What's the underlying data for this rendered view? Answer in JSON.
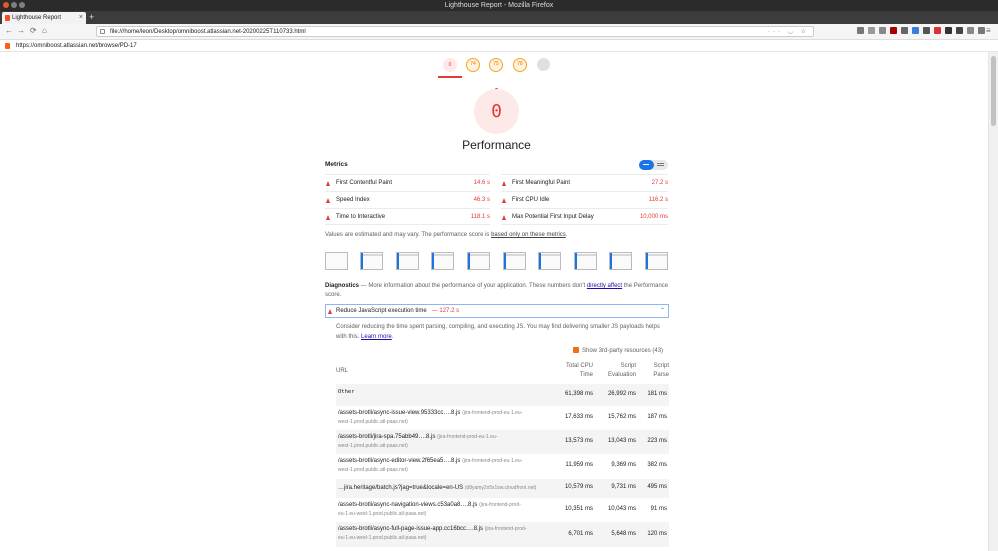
{
  "window": {
    "title": "Lighthouse Report - Mozilla Firefox"
  },
  "tab": {
    "title": "Lighthouse Report"
  },
  "navigation": {
    "url": "file:///home/leon/Desktop/omniboost.atlassian.net-20200225T110733.html"
  },
  "report_url": "https://omniboost.atlassian.net/browse/PD-17",
  "category_gauges": [
    {
      "score": "0",
      "status": "fail"
    },
    {
      "score": "74",
      "status": "average"
    },
    {
      "score": "75",
      "status": "average"
    },
    {
      "score": "78",
      "status": "average"
    },
    {
      "score": "",
      "status": "pwa"
    }
  ],
  "performance": {
    "score": "0",
    "title": "Performance"
  },
  "metrics": {
    "heading": "Metrics",
    "items": [
      {
        "label": "First Contentful Paint",
        "value": "14.6 s"
      },
      {
        "label": "First Meaningful Paint",
        "value": "27.2 s"
      },
      {
        "label": "Speed Index",
        "value": "46.3 s"
      },
      {
        "label": "First CPU Idle",
        "value": "116.2 s"
      },
      {
        "label": "Time to Interactive",
        "value": "118.1 s"
      },
      {
        "label": "Max Potential First Input Delay",
        "value": "10,000 ms"
      }
    ],
    "note_prefix": "Values are estimated and may vary. The performance score is ",
    "note_link": "based only on these metrics",
    "note_suffix": "."
  },
  "diagnostics": {
    "heading": "Diagnostics",
    "text_prefix": " — More information about the performance of your application. These numbers don't ",
    "link": "directly affect",
    "text_suffix": " the Performance score."
  },
  "opportunity": {
    "title": "Reduce JavaScript execution time",
    "value": "— 127.2 s",
    "description": "Consider reducing the time spent parsing, compiling, and executing JS. You may find delivering smaller JS payloads helps with this. ",
    "learn_more": "Learn more",
    "learn_more_suffix": "."
  },
  "third_party": {
    "label": "Show 3rd-party resources (43)"
  },
  "table": {
    "headers": {
      "url": "URL",
      "total_1": "Total CPU",
      "total_2": "Time",
      "eval_1": "Script",
      "eval_2": "Evaluation",
      "parse_1": "Script",
      "parse_2": "Parse"
    },
    "rows": [
      {
        "url": "Other",
        "host": "",
        "cont": "",
        "total": "61,398 ms",
        "eval": "26,992 ms",
        "parse": "181 ms"
      },
      {
        "url": "/assets-brotli/async-issue-view.95333cc….8.js",
        "host": "(jira-frontend-prod-eu-1.eu-",
        "cont": "west-1.prod.public.atl-paas.net)",
        "total": "17,633 ms",
        "eval": "15,762 ms",
        "parse": "187 ms"
      },
      {
        "url": "/assets-brotli/jira-spa.75abb49….8.js",
        "host": "(jira-frontend-prod-eu-1.eu-",
        "cont": "west-1.prod.public.atl-paas.net)",
        "total": "13,573 ms",
        "eval": "13,043 ms",
        "parse": "223 ms"
      },
      {
        "url": "/assets-brotli/async-editor-view.2f65ea5….8.js",
        "host": "(jira-frontend-prod-eu-1.eu-",
        "cont": "west-1.prod.public.atl-paas.net)",
        "total": "11,959 ms",
        "eval": "9,369 ms",
        "parse": "382 ms"
      },
      {
        "url": "…jira.heritage/batch.js?jag=true&locale=en-US",
        "host": "(d8yamy2x5x1sw.cloudfront.net)",
        "cont": "",
        "total": "10,579 ms",
        "eval": "9,731 ms",
        "parse": "495 ms"
      },
      {
        "url": "/assets-brotli/async-navigation-views.c53a0a8….8.js",
        "host": "(jira-frontend-prod-",
        "cont": "eu-1.eu-west-1.prod.public.atl-paas.net)",
        "total": "10,351 ms",
        "eval": "10,043 ms",
        "parse": "91 ms"
      },
      {
        "url": "/assets-brotli/async-full-page-issue-app.cc16bcc….8.js",
        "host": "(jira-frontend-prod-",
        "cont": "eu-1.eu-west-1.prod.public.atl-paas.net)",
        "total": "6,701 ms",
        "eval": "5,648 ms",
        "parse": "120 ms"
      }
    ]
  },
  "colors": {
    "fail": "#e53935",
    "average": "#e67700",
    "accent": "#1a73e8"
  }
}
